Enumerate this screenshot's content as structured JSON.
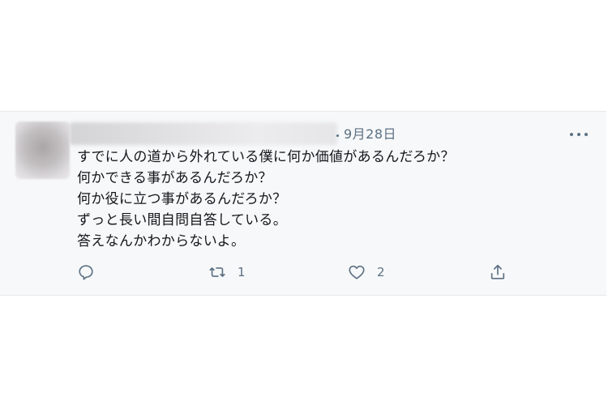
{
  "tweet": {
    "date": "9月28日",
    "body_lines": [
      "すでに人の道から外れている僕に何か価値があるんだろか？",
      "何かできる事があるんだろか？",
      "何か役に立つ事があるんだろか？",
      "ずっと長い間自問自答している。",
      "答えなんかわからないよ。"
    ],
    "actions": {
      "reply_icon": "reply-icon",
      "retweet_icon": "retweet-icon",
      "retweet_count": "1",
      "like_icon": "heart-icon",
      "like_count": "2",
      "share_icon": "share-icon"
    },
    "more_icon": "more-horizontal-icon"
  },
  "colors": {
    "card_bg": "#f7f8f9",
    "text": "#14171a",
    "secondary": "#5b7083"
  }
}
